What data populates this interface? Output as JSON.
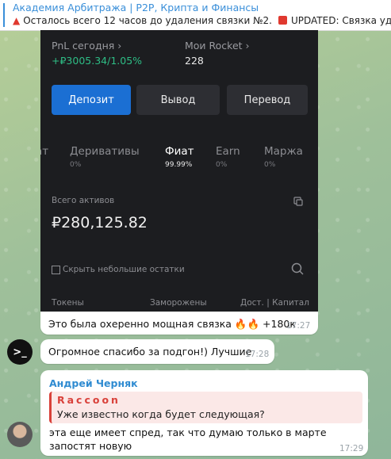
{
  "pinned": {
    "title": "Академия Арбитража | P2P, Крипта и Финансы",
    "message": "Осталось всего 12 часов до удаления связки №2.",
    "message2": "UPDATED: Связка удале"
  },
  "screenshot": {
    "pnl_label": "PnL сегодня ›",
    "pnl_value": "+₽3005.34/1.05%",
    "rocket_label": "Мои Rocket ›",
    "rocket_value": "228",
    "buttons": {
      "deposit": "Депозит",
      "withdraw": "Вывод",
      "transfer": "Перевод"
    },
    "tabs": [
      {
        "label": "ат",
        "pct": ""
      },
      {
        "label": "Деривативы",
        "pct": "0%"
      },
      {
        "label": "Фиат",
        "pct": "99.99%"
      },
      {
        "label": "Earn",
        "pct": "0%"
      },
      {
        "label": "Маржа",
        "pct": "0%"
      }
    ],
    "assets_label": "Всего активов",
    "assets_value": "₽280,125.82",
    "hide_small": "Скрыть небольшие остатки",
    "columns": [
      "Токены",
      "Заморожены",
      "Дост. | Капитал"
    ]
  },
  "messages": [
    {
      "text": "Это была охеренно мощная связка 🔥🔥 +180к",
      "time": "17:27"
    },
    {
      "text": "Огромное спасибо за подгон!) Лучшие",
      "time": "17:28"
    },
    {
      "sender": "Андрей Черняк",
      "quote_name": "Raccoon",
      "quote_text": "Уже известно когда будет следующая?",
      "text": "эта еще имеет спред, так что думаю только в марте запостят новую",
      "time": "17:29"
    }
  ],
  "avatar1_glyph": ">_",
  "colors": {
    "accent": "#3a8fd9",
    "positive": "#2ebd85",
    "deposit": "#1b6fd3",
    "quote": "#d9413a"
  }
}
